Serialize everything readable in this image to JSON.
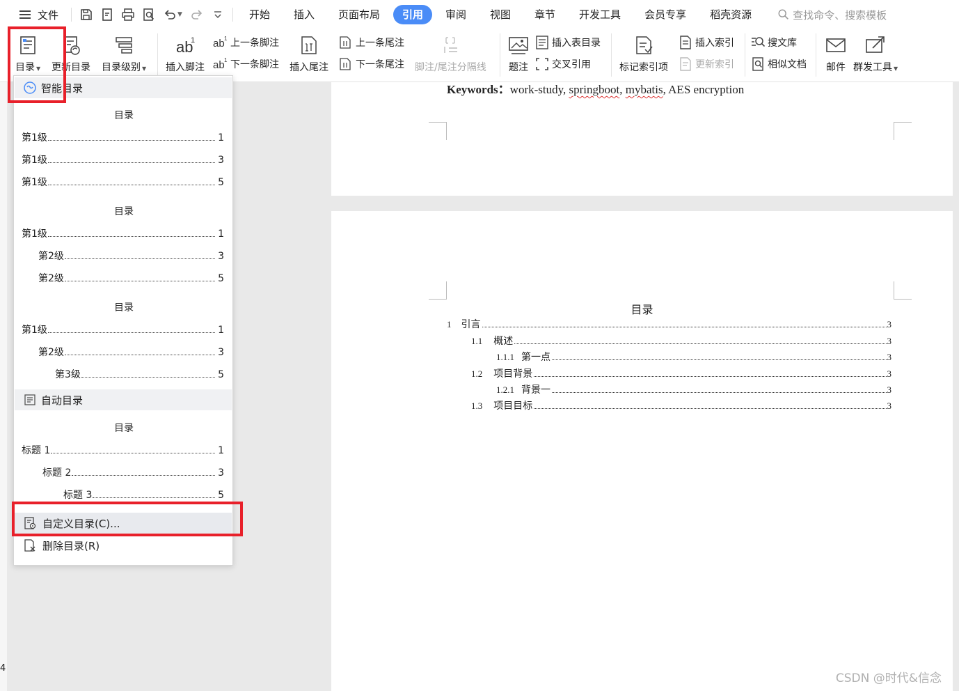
{
  "menubar": {
    "file": "文件",
    "tabs": [
      "开始",
      "插入",
      "页面布局",
      "引用",
      "审阅",
      "视图",
      "章节",
      "开发工具",
      "会员专享",
      "稻壳资源"
    ],
    "active_tab": "引用",
    "search_placeholder": "查找命令、搜索模板"
  },
  "ribbon": {
    "toc": "目录",
    "update_toc": "更新目录",
    "toc_level": "目录级别",
    "insert_footnote": "插入脚注",
    "prev_footnote": "上一条脚注",
    "next_footnote": "下一条脚注",
    "insert_endnote": "插入尾注",
    "prev_endnote": "上一条尾注",
    "next_endnote": "下一条尾注",
    "separator_line": "脚注/尾注分隔线",
    "caption": "题注",
    "insert_table_of_figures": "插入表目录",
    "cross_reference": "交叉引用",
    "mark_index_entry": "标记索引项",
    "insert_index": "插入索引",
    "update_index": "更新索引",
    "search_library": "搜文库",
    "similar_docs": "相似文档",
    "mail": "邮件",
    "mass_send_tools": "群发工具"
  },
  "dropdown": {
    "smart_toc": "智能目录",
    "auto_toc": "自动目录",
    "custom_toc": "自定义目录(C)...",
    "delete_toc": "删除目录(R)",
    "templates": [
      {
        "title": "目录",
        "rows": [
          {
            "text": "第1级",
            "page": "1"
          },
          {
            "text": "第1级",
            "page": "3"
          },
          {
            "text": "第1级",
            "page": "5"
          }
        ]
      },
      {
        "title": "目录",
        "rows": [
          {
            "text": "第1级",
            "page": "1"
          },
          {
            "text": "第2级",
            "page": "3"
          },
          {
            "text": "第2级",
            "page": "5"
          }
        ]
      },
      {
        "title": "目录",
        "rows": [
          {
            "text": "第1级",
            "page": "1"
          },
          {
            "text": "第2级",
            "page": "3"
          },
          {
            "text": "第3级",
            "page": "5"
          }
        ]
      }
    ],
    "auto_template": {
      "title": "目录",
      "rows": [
        {
          "text": "标题 1",
          "page": "1"
        },
        {
          "text": "标题 2",
          "page": "3"
        },
        {
          "text": "标题 3",
          "page": "5"
        }
      ]
    }
  },
  "document": {
    "keywords_label": "Keywords：",
    "keywords_parts": [
      "work-study, ",
      "springboot",
      ", ",
      "mybatis",
      ", AES encryption"
    ],
    "toc_title": "目录",
    "toc": [
      {
        "num": "1",
        "text": "引言",
        "page": "3"
      },
      {
        "num": "1.1",
        "text": "概述",
        "page": "3"
      },
      {
        "num": "1.1.1",
        "text": "第一点",
        "page": "3"
      },
      {
        "num": "1.2",
        "text": "项目背景",
        "page": "3"
      },
      {
        "num": "1.2.1",
        "text": "背景一",
        "page": "3"
      },
      {
        "num": "1.3",
        "text": "项目目标",
        "page": "3"
      }
    ]
  },
  "left_number": "4",
  "watermark": "CSDN @时代&信念"
}
